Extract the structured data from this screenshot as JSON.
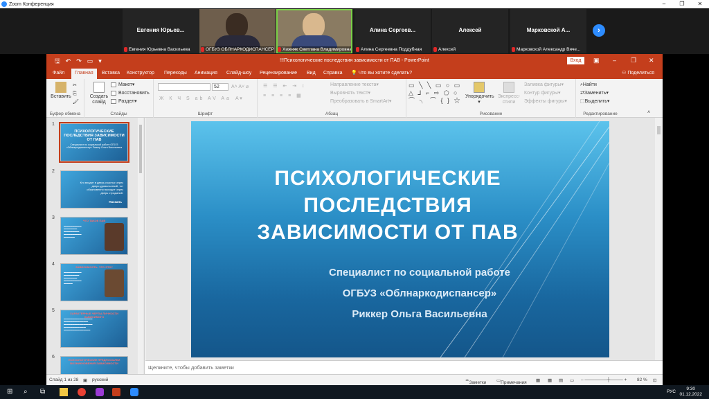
{
  "zoom": {
    "window_title": "Zoom Конференция",
    "participants": [
      {
        "name": "Евгения Юрьев...",
        "label": "Евгения Юрьевна Васильева",
        "video": false
      },
      {
        "name": "",
        "label": "ОГБУЗ ОБЛНАРКОДИСПАНСЕР",
        "video": true
      },
      {
        "name": "",
        "label": "Хижняк Светлана Владимировна",
        "video": true,
        "active": true
      },
      {
        "name": "Алина Сергеев...",
        "label": "Алина Сергеевна Поддубная",
        "video": false
      },
      {
        "name": "Алексей",
        "label": "Алексей",
        "video": false
      },
      {
        "name": "Марковской А...",
        "label": "Марковской Александр Вяче...",
        "video": false
      }
    ]
  },
  "ppt": {
    "title": "!!!Психологические последствия зависимости от ПАВ  -  PowerPoint",
    "login": "Вход",
    "tabs": [
      "Файл",
      "Главная",
      "Вставка",
      "Конструктор",
      "Переходы",
      "Анимация",
      "Слайд-шоу",
      "Рецензирование",
      "Вид",
      "Справка",
      "Что вы хотите сделать?"
    ],
    "share": "Поделиться",
    "ribbon": {
      "clipboard": {
        "label": "Буфер обмена",
        "paste": "Вставить"
      },
      "slides": {
        "label": "Слайды",
        "new_slide": "Создать слайд",
        "layout": "Макет",
        "reset": "Восстановить",
        "section": "Раздел"
      },
      "font": {
        "label": "Шрифт",
        "size": "52"
      },
      "paragraph": {
        "label": "Абзац",
        "direction": "Направление текста",
        "align": "Выровнять текст",
        "smartart": "Преобразовать в SmartArt"
      },
      "drawing": {
        "label": "Рисование",
        "arrange": "Упорядочить",
        "quick_styles": "Экспресс-стили",
        "fill": "Заливка фигуры",
        "outline": "Контур фигуры",
        "effects": "Эффекты фигуры"
      },
      "editing": {
        "label": "Редактирование",
        "find": "Найти",
        "replace": "Заменить",
        "select": "Выделить"
      }
    },
    "thumbnails": [
      {
        "num": "1",
        "main": "ПСИХОЛОГИЧЕСКИЕ ПОСЛЕДСТВИЯ ЗАВИСИМОСТИ ОТ ПАВ",
        "sub": "Специалист по социальной работе ОГБУЗ «Облнаркодиспансер» Риккер Ольга Васильевна"
      },
      {
        "num": "2",
        "quote": "Кто входит в дверь счастья через дверь удовольствий, тот обыкновенно выходит через дверь страданий.",
        "sig": "Паскаль"
      },
      {
        "num": "3",
        "heading": "ЧТО ТАКОЕ ПАВ"
      },
      {
        "num": "4",
        "heading": "ЗАВИСИМОСТЬ. ЧТО ЭТО?"
      },
      {
        "num": "5",
        "heading": "ХАРАКТЕРНЫЕ ЧЕРТЫ ЛИЧНОСТИ ЗАВИСИМОГО"
      },
      {
        "num": "6",
        "heading": "ПСИХОЛОГИЧЕСКИЕ ПРЕДПОСЫЛКИ ВОЗНИКНОВЕНИЯ ЗАВИСИМОСТИ"
      }
    ],
    "slide": {
      "title": "ПСИХОЛОГИЧЕСКИЕ ПОСЛЕДСТВИЯ ЗАВИСИМОСТИ ОТ ПАВ",
      "subtitle_1": "Специалист по социальной работе",
      "subtitle_2": "ОГБУЗ «Облнаркодиспансер»",
      "subtitle_3": "Риккер Ольга Васильевна"
    },
    "notes_placeholder": "Щелкните, чтобы добавить заметки",
    "status": {
      "slide": "Слайд 1 из 28",
      "lang": "русский",
      "notes": "Заметки",
      "comments": "Примечания",
      "zoom": "82 %"
    }
  },
  "taskbar": {
    "time": "9:30",
    "date": "01.12.2022",
    "lang": "РУС"
  }
}
